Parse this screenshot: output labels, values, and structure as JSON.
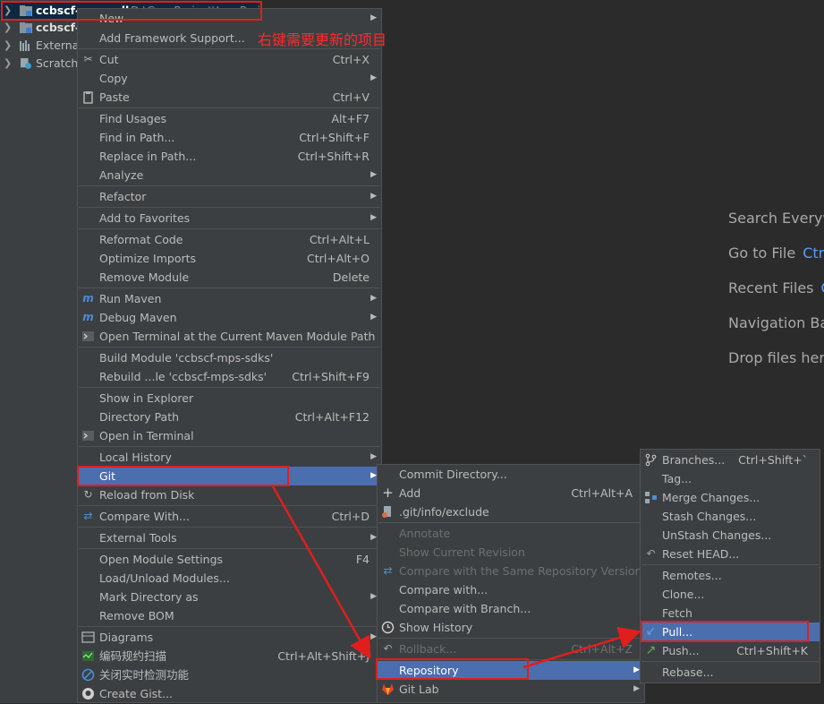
{
  "project_tree": {
    "items": [
      {
        "label": "ccbscf-mps-sdks",
        "suffix": "D:\\Gsp_Project\\JavaProj"
      },
      {
        "label": "ccbscf-r"
      },
      {
        "label": "External"
      },
      {
        "label": "Scratche"
      }
    ]
  },
  "annotation": {
    "text": "右键需要更新的项目"
  },
  "welcome": {
    "search": "Search Everyw",
    "goto_file": "Go to File",
    "goto_file_key": "Ctr",
    "recent_files": "Recent Files",
    "recent_files_key": "C",
    "navigation_bar": "Navigation Ba",
    "drop_files": "Drop files here"
  },
  "context_menu": {
    "items": [
      {
        "label": "New",
        "shortcut": "",
        "submenu": true,
        "icon": ""
      },
      {
        "label": "Add Framework Support...",
        "shortcut": "",
        "submenu": false,
        "icon": ""
      },
      {
        "label": "Cut",
        "shortcut": "Ctrl+X",
        "submenu": false,
        "icon": "scissors-icon"
      },
      {
        "label": "Copy",
        "shortcut": "",
        "submenu": true,
        "icon": ""
      },
      {
        "label": "Paste",
        "shortcut": "Ctrl+V",
        "submenu": false,
        "icon": "clipboard-icon"
      },
      {
        "label": "Find Usages",
        "shortcut": "Alt+F7",
        "submenu": false,
        "icon": ""
      },
      {
        "label": "Find in Path...",
        "shortcut": "Ctrl+Shift+F",
        "submenu": false,
        "icon": ""
      },
      {
        "label": "Replace in Path...",
        "shortcut": "Ctrl+Shift+R",
        "submenu": false,
        "icon": ""
      },
      {
        "label": "Analyze",
        "shortcut": "",
        "submenu": true,
        "icon": ""
      },
      {
        "label": "Refactor",
        "shortcut": "",
        "submenu": true,
        "icon": ""
      },
      {
        "label": "Add to Favorites",
        "shortcut": "",
        "submenu": true,
        "icon": ""
      },
      {
        "label": "Reformat Code",
        "shortcut": "Ctrl+Alt+L",
        "submenu": false,
        "icon": ""
      },
      {
        "label": "Optimize Imports",
        "shortcut": "Ctrl+Alt+O",
        "submenu": false,
        "icon": ""
      },
      {
        "label": "Remove Module",
        "shortcut": "Delete",
        "submenu": false,
        "icon": ""
      },
      {
        "label": "Run Maven",
        "shortcut": "",
        "submenu": true,
        "icon": "maven-icon"
      },
      {
        "label": "Debug Maven",
        "shortcut": "",
        "submenu": true,
        "icon": "maven-icon"
      },
      {
        "label": "Open Terminal at the Current Maven Module Path",
        "shortcut": "",
        "submenu": false,
        "icon": "terminal-icon"
      },
      {
        "label": "Build Module 'ccbscf-mps-sdks'",
        "shortcut": "",
        "submenu": false,
        "icon": ""
      },
      {
        "label": "Rebuild ...le 'ccbscf-mps-sdks'",
        "shortcut": "Ctrl+Shift+F9",
        "submenu": false,
        "icon": ""
      },
      {
        "label": "Show in Explorer",
        "shortcut": "",
        "submenu": false,
        "icon": ""
      },
      {
        "label": "Directory Path",
        "shortcut": "Ctrl+Alt+F12",
        "submenu": false,
        "icon": ""
      },
      {
        "label": "Open in Terminal",
        "shortcut": "",
        "submenu": false,
        "icon": "terminal-icon"
      },
      {
        "label": "Local History",
        "shortcut": "",
        "submenu": true,
        "icon": ""
      },
      {
        "label": "Git",
        "shortcut": "",
        "submenu": true,
        "icon": "",
        "selected": true
      },
      {
        "label": "Reload from Disk",
        "shortcut": "",
        "submenu": false,
        "icon": "reload-icon"
      },
      {
        "label": "Compare With...",
        "shortcut": "Ctrl+D",
        "submenu": false,
        "icon": "compare-icon"
      },
      {
        "label": "External Tools",
        "shortcut": "",
        "submenu": true,
        "icon": ""
      },
      {
        "label": "Open Module Settings",
        "shortcut": "F4",
        "submenu": false,
        "icon": ""
      },
      {
        "label": "Load/Unload Modules...",
        "shortcut": "",
        "submenu": false,
        "icon": ""
      },
      {
        "label": "Mark Directory as",
        "shortcut": "",
        "submenu": true,
        "icon": ""
      },
      {
        "label": "Remove BOM",
        "shortcut": "",
        "submenu": false,
        "icon": ""
      },
      {
        "label": "Diagrams",
        "shortcut": "",
        "submenu": true,
        "icon": "diagram-icon"
      },
      {
        "label": "编码规约扫描",
        "shortcut": "Ctrl+Alt+Shift+J",
        "submenu": false,
        "icon": "scan-icon"
      },
      {
        "label": "关闭实时检测功能",
        "shortcut": "",
        "submenu": false,
        "icon": "disable-icon"
      },
      {
        "label": "Create Gist...",
        "shortcut": "",
        "submenu": false,
        "icon": "github-icon"
      }
    ]
  },
  "git_menu": {
    "items": [
      {
        "label": "Commit Directory...",
        "shortcut": "",
        "submenu": false,
        "icon": ""
      },
      {
        "label": "Add",
        "shortcut": "Ctrl+Alt+A",
        "submenu": false,
        "icon": "plus-icon"
      },
      {
        "label": ".git/info/exclude",
        "shortcut": "",
        "submenu": false,
        "icon": "git-file-icon"
      },
      {
        "label": "Annotate",
        "shortcut": "",
        "submenu": false,
        "icon": "",
        "disabled": true
      },
      {
        "label": "Show Current Revision",
        "shortcut": "",
        "submenu": false,
        "icon": "",
        "disabled": true
      },
      {
        "label": "Compare with the Same Repository Version",
        "shortcut": "",
        "submenu": false,
        "icon": "compare-icon",
        "disabled": true
      },
      {
        "label": "Compare with...",
        "shortcut": "",
        "submenu": false,
        "icon": ""
      },
      {
        "label": "Compare with Branch...",
        "shortcut": "",
        "submenu": false,
        "icon": ""
      },
      {
        "label": "Show History",
        "shortcut": "",
        "submenu": false,
        "icon": "clock-icon"
      },
      {
        "label": "Rollback...",
        "shortcut": "Ctrl+Alt+Z",
        "submenu": false,
        "icon": "undo-icon",
        "disabled": true
      },
      {
        "label": "Repository",
        "shortcut": "",
        "submenu": true,
        "icon": "",
        "selected": true
      },
      {
        "label": "Git Lab",
        "shortcut": "",
        "submenu": true,
        "icon": "gitlab-icon"
      }
    ]
  },
  "repository_menu": {
    "items": [
      {
        "label": "Branches...",
        "shortcut": "Ctrl+Shift+`",
        "submenu": false,
        "icon": "branch-icon"
      },
      {
        "label": "Tag...",
        "shortcut": "",
        "submenu": false,
        "icon": ""
      },
      {
        "label": "Merge Changes...",
        "shortcut": "",
        "submenu": false,
        "icon": "merge-icon"
      },
      {
        "label": "Stash Changes...",
        "shortcut": "",
        "submenu": false,
        "icon": ""
      },
      {
        "label": "UnStash Changes...",
        "shortcut": "",
        "submenu": false,
        "icon": ""
      },
      {
        "label": "Reset HEAD...",
        "shortcut": "",
        "submenu": false,
        "icon": "undo-icon"
      },
      {
        "label": "Remotes...",
        "shortcut": "",
        "submenu": false,
        "icon": ""
      },
      {
        "label": "Clone...",
        "shortcut": "",
        "submenu": false,
        "icon": ""
      },
      {
        "label": "Fetch",
        "shortcut": "",
        "submenu": false,
        "icon": ""
      },
      {
        "label": "Pull...",
        "shortcut": "",
        "submenu": false,
        "icon": "pull-icon",
        "selected": true
      },
      {
        "label": "Push...",
        "shortcut": "Ctrl+Shift+K",
        "submenu": false,
        "icon": "push-icon"
      },
      {
        "label": "Rebase...",
        "shortcut": "",
        "submenu": false,
        "icon": ""
      }
    ]
  },
  "colors": {
    "selection": "#4b6eaf",
    "annotation": "#e01e1e",
    "menu_bg": "#3c3f41",
    "editor_bg": "#2b2b2b"
  }
}
